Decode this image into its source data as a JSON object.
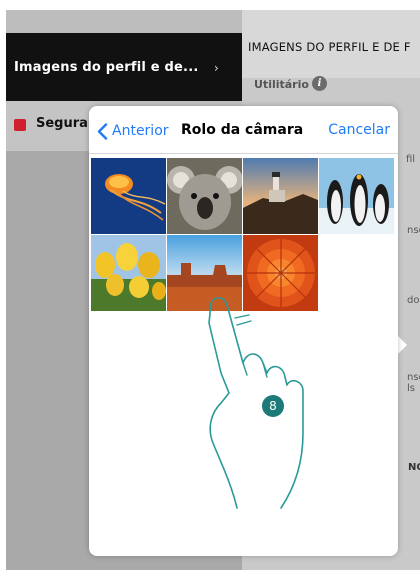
{
  "sidebar": {
    "items": [
      {
        "label": "Imagens do perfil e de...",
        "chevron": "›",
        "active": true
      },
      {
        "label": "Seguran",
        "badge_color": "#d01f2e"
      }
    ]
  },
  "right_panel": {
    "title": "IMAGENS DO PERFIL E DE F",
    "user_label": "Utilitário",
    "info_icon": "i",
    "fragments": [
      "fil",
      "nse",
      "do d",
      "nse",
      "ls",
      "NCE"
    ]
  },
  "picker": {
    "back_label": "Anterior",
    "title": "Rolo da câmara",
    "cancel_label": "Cancelar",
    "photos": [
      "jellyfish",
      "koala",
      "lighthouse",
      "penguins",
      "tulips",
      "desert",
      "chrysanthemum"
    ]
  },
  "annotation": {
    "step_number": "8",
    "accent_color": "#1c7a79"
  },
  "colors": {
    "link_blue": "#1f7cf5",
    "sidebar_active": "#111111"
  }
}
